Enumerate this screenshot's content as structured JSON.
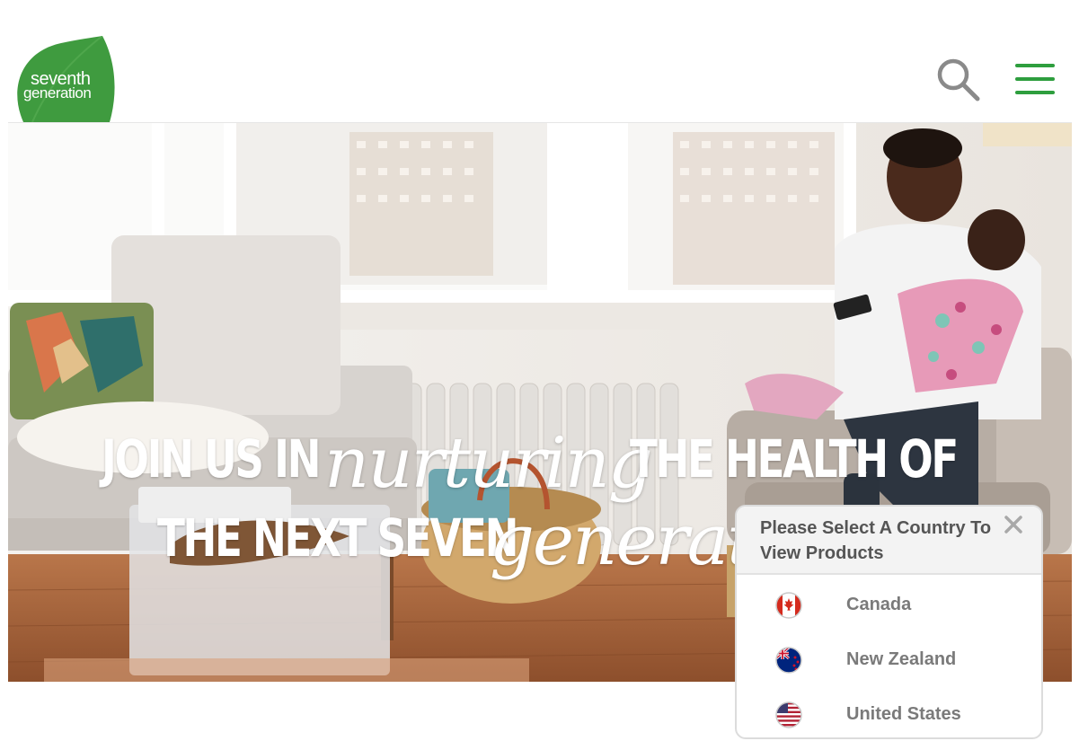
{
  "brand": {
    "logo_line1": "seventh",
    "logo_line2": "generation",
    "green": "#3a9a3a"
  },
  "header": {
    "search_icon": "search-icon",
    "menu_icon": "hamburger-menu-icon",
    "menu_color": "#2e9e3e"
  },
  "hero": {
    "line1_a": "JOIN US IN",
    "line1_script": "nurturing",
    "line1_b": "THE HEALTH OF",
    "line2_a": "THE NEXT SEVEN",
    "line2_script": "generations"
  },
  "country_popup": {
    "title": "Please Select A Country To View Products",
    "close_icon": "close-icon",
    "countries": [
      {
        "name": "Canada",
        "flag": "canada-flag-icon"
      },
      {
        "name": "New Zealand",
        "flag": "new-zealand-flag-icon"
      },
      {
        "name": "United States",
        "flag": "united-states-flag-icon"
      }
    ]
  }
}
